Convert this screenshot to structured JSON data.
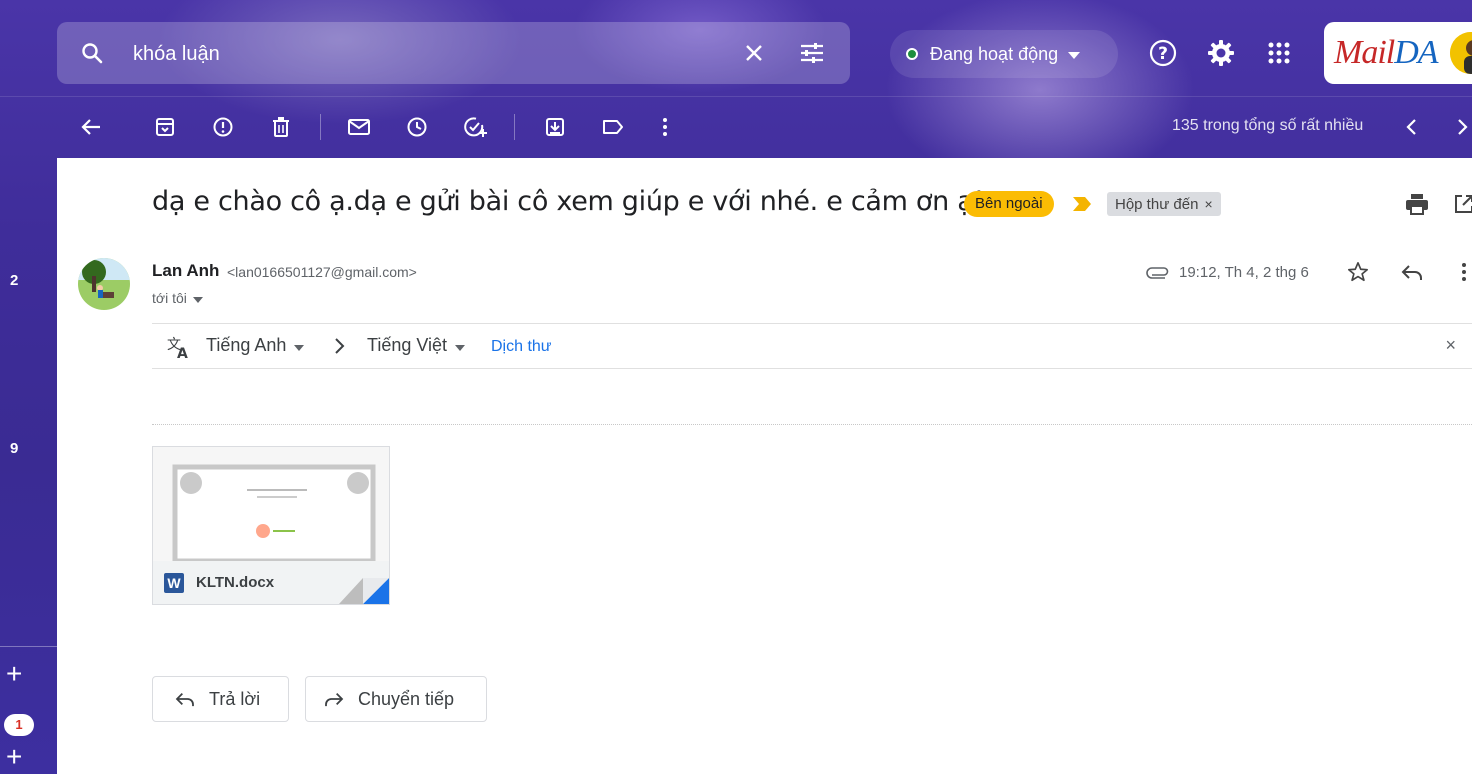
{
  "search": {
    "query": "khóa luận"
  },
  "header": {
    "status": "Đang hoạt động"
  },
  "account": {
    "logo_part1": "Mail",
    "logo_part2": "DA"
  },
  "toolbar": {
    "paging": "135 trong tổng số rất nhiều"
  },
  "rail": {
    "count_a": "2",
    "count_b": "9",
    "badge": "1"
  },
  "email": {
    "subject": "dạ e chào cô ạ.dạ e gửi bài cô xem giúp e với nhé. e cảm ơn ạ!",
    "labels": {
      "external": "Bên ngoài",
      "inbox": "Hộp thư đến",
      "inbox_remove": "×"
    },
    "sender": {
      "name": "Lan Anh",
      "email": "<lan0166501127@gmail.com>"
    },
    "recipient": "tới tôi",
    "time": "19:12, Th 4, 2 thg 6"
  },
  "translate": {
    "from": "Tiếng Anh",
    "to": "Tiếng Việt",
    "link": "Dịch thư",
    "close": "×"
  },
  "attachment": {
    "name": "KLTN.docx",
    "type_letter": "W"
  },
  "actions": {
    "reply": "Trả lời",
    "forward": "Chuyển tiếp"
  },
  "colors": {
    "accent": "#4a35a8",
    "label_external": "#fbbc04",
    "label_inbox": "#dadce0",
    "link": "#1a73e8",
    "status_online": "#1e8e3e"
  }
}
